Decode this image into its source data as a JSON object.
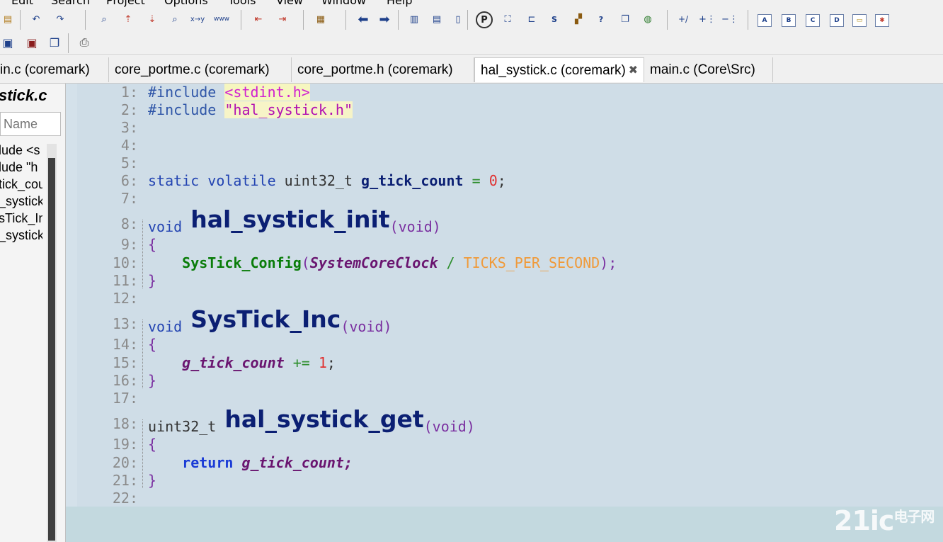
{
  "menu": [
    "Edit",
    "Search",
    "Project",
    "Options",
    "Tools",
    "View",
    "Window",
    "Help"
  ],
  "tabs": [
    {
      "label": "in.c (coremark)",
      "active": false
    },
    {
      "label": "core_portme.c (coremark)",
      "active": false
    },
    {
      "label": "core_portme.h (coremark)",
      "active": false
    },
    {
      "label": "hal_systick.c (coremark)",
      "active": true
    },
    {
      "label": "main.c (Core\\Src)",
      "active": false
    }
  ],
  "tab_close": "✖",
  "panel": {
    "title": "stick.c",
    "search_placeholder": "Name",
    "symbols": [
      "lude <s",
      "lude \"h",
      "tick_cou",
      "_systick",
      "sTick_In",
      "_systick"
    ]
  },
  "code": {
    "line_numbers": [
      "1:",
      "2:",
      "3:",
      "4:",
      "5:",
      "6:",
      "7:",
      "8:",
      "9:",
      "10:",
      "11:",
      "12:",
      "13:",
      "14:",
      "15:",
      "16:",
      "17:",
      "18:",
      "19:",
      "20:",
      "21:",
      "22:"
    ],
    "l1_dir": "#include",
    "l1_arg": "<stdint.h>",
    "l2_dir": "#include",
    "l2_arg": "\"hal_systick.h\"",
    "l6_static": "static",
    "l6_volatile": "volatile",
    "l6_type": "uint32_t",
    "l6_var": "g_tick_count",
    "l6_eq": "=",
    "l6_num": "0",
    "l6_semi": ";",
    "l8_type": "void",
    "l8_fn": "hal_systick_init",
    "l8_args": "(void)",
    "open_brace": "{",
    "close_brace": "}",
    "l10_call": "SysTick_Config",
    "l10_open": "(",
    "l10_arg1": "SystemCoreClock",
    "l10_div": "/",
    "l10_arg2": "TICKS_PER_SECOND",
    "l10_close": ");",
    "l13_type": "void",
    "l13_fn": "SysTick_Inc",
    "l13_args": "(void)",
    "l15_var": "g_tick_count",
    "l15_op": "+=",
    "l15_num": "1",
    "l15_semi": ";",
    "l18_type": "uint32_t",
    "l18_fn": "hal_systick_get",
    "l18_args": "(void)",
    "l20_ret": "return",
    "l20_var": "g_tick_count;"
  },
  "watermark": {
    "main": "21ic",
    "sub": "电子网"
  },
  "colors": {
    "editor_bg": "#cfdde7",
    "function_name": "#0b1f73",
    "keyword": "#2344b2",
    "macro": "#f09a3a"
  },
  "toolbar_icons": [
    "open-icon",
    "undo-icon",
    "redo-icon",
    "find-icon",
    "replace-icon",
    "bookmark-icon",
    "back-icon",
    "forward-icon",
    "print-icon",
    "save-icon"
  ]
}
